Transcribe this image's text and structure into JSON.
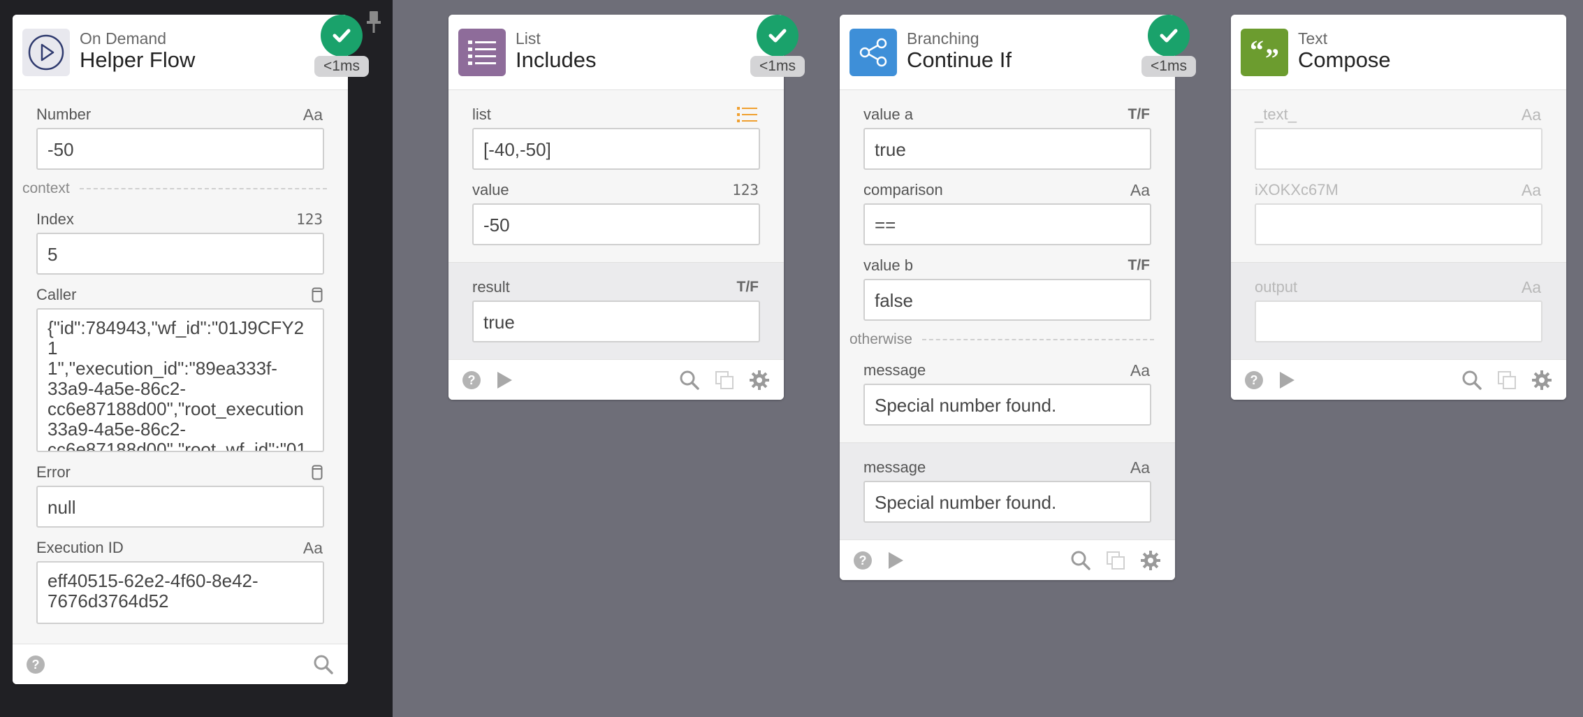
{
  "colors": {
    "background": "#6e6e78",
    "left_panel": "#202024",
    "success": "#1aa26b",
    "list_icon": "#8e6c9a",
    "branch_icon": "#3e8fd8",
    "text_icon": "#6c9c2f",
    "list_type_icon": "#f0a030"
  },
  "cards": {
    "helper": {
      "category": "On Demand",
      "title": "Helper Flow",
      "icon": "play-circle-icon",
      "badge_time": "<1ms",
      "fields": [
        {
          "label": "Number",
          "type": "Aa",
          "value": "-50"
        },
        {
          "label": "Index",
          "type": "123",
          "value": "5"
        },
        {
          "label": "Caller",
          "type": "database-icon",
          "value": "{\"id\":784943,\"wf_id\":\"01J9CFY21\n1\",\"execution_id\":\"89ea333f-\n33a9-4a5e-86c2-\ncc6e87188d00\",\"root_execution\n33a9-4a5e-86c2-\ncc6e87188d00\",\"root_wf_id\":\"01"
        },
        {
          "label": "Error",
          "type": "database-icon",
          "value": "null"
        },
        {
          "label": "Execution ID",
          "type": "Aa",
          "value": "eff40515-62e2-4f60-8e42-\n7676d3764d52"
        }
      ],
      "section_label": "context"
    },
    "list": {
      "category": "List",
      "title": "Includes",
      "icon": "list-icon",
      "badge_time": "<1ms",
      "fields": [
        {
          "label": "list",
          "type": "list-icon",
          "value": "[-40,-50]"
        },
        {
          "label": "value",
          "type": "123",
          "value": "-50"
        }
      ],
      "output": {
        "label": "result",
        "type": "T/F",
        "value": "true"
      }
    },
    "branch": {
      "category": "Branching",
      "title": "Continue If",
      "icon": "share-icon",
      "badge_time": "<1ms",
      "fields": [
        {
          "label": "value a",
          "type": "T/F",
          "value": "true"
        },
        {
          "label": "comparison",
          "type": "Aa",
          "value": "=="
        },
        {
          "label": "value b",
          "type": "T/F",
          "value": "false"
        },
        {
          "label": "message",
          "type": "Aa",
          "value": "Special number found."
        }
      ],
      "section_label": "otherwise",
      "output": {
        "label": "message",
        "type": "Aa",
        "value": "Special number found."
      }
    },
    "text": {
      "category": "Text",
      "title": "Compose",
      "icon": "quote-icon",
      "fields": [
        {
          "label": "_text_",
          "type": "Aa",
          "value": ""
        },
        {
          "label": "iXOKXc67M",
          "type": "Aa",
          "value": ""
        }
      ],
      "output": {
        "label": "output",
        "type": "Aa",
        "value": ""
      }
    }
  }
}
